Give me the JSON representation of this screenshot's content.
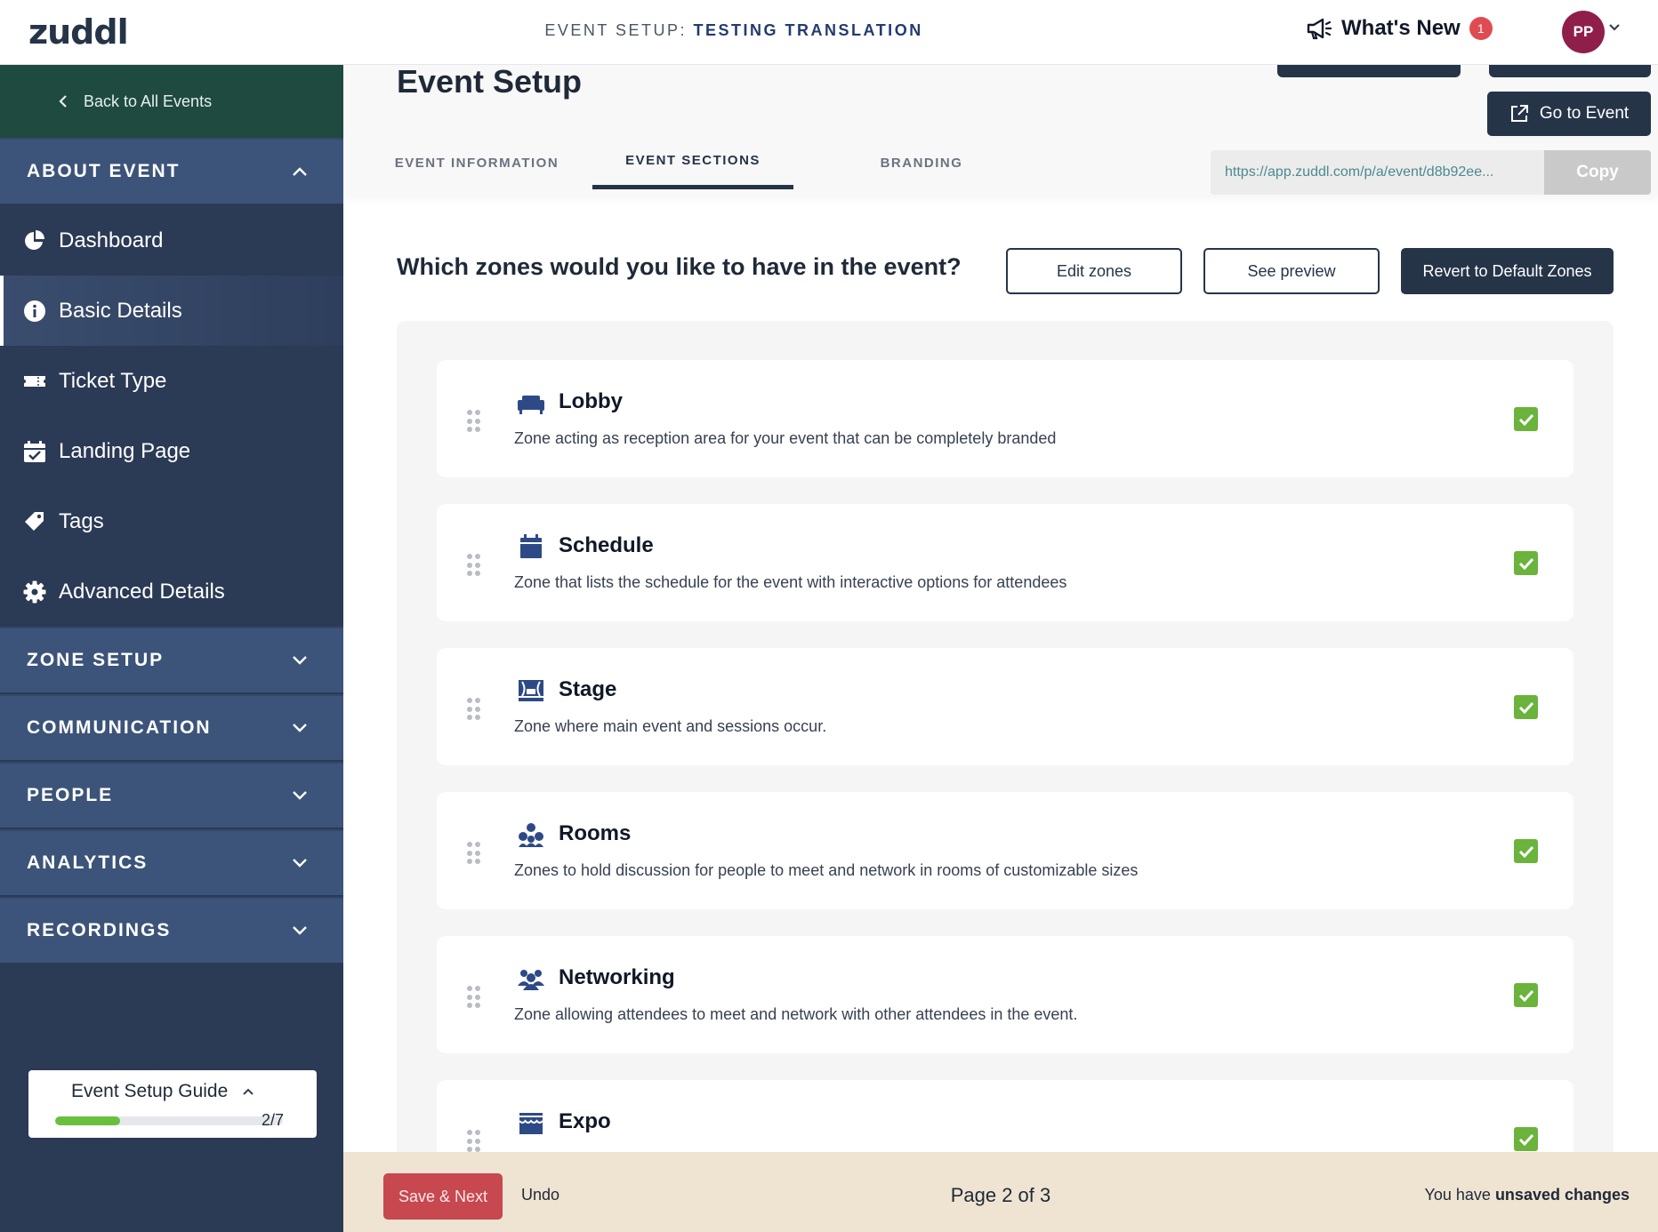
{
  "topbar": {
    "logo": "zuddl",
    "crumb_prefix": "EVENT SETUP:",
    "crumb_event": "TESTING TRANSLATION",
    "whats_new": "What's New",
    "whats_new_count": "1",
    "avatar_initials": "PP"
  },
  "sidebar": {
    "back_label": "Back to All Events",
    "about_event": "ABOUT EVENT",
    "items": [
      {
        "label": "Dashboard",
        "icon": "pie-chart-icon"
      },
      {
        "label": "Basic Details",
        "icon": "info-icon"
      },
      {
        "label": "Ticket Type",
        "icon": "ticket-icon"
      },
      {
        "label": "Landing Page",
        "icon": "calendar-check-icon"
      },
      {
        "label": "Tags",
        "icon": "tag-icon"
      },
      {
        "label": "Advanced Details",
        "icon": "gear-icon"
      }
    ],
    "sections": [
      "ZONE SETUP",
      "COMMUNICATION",
      "PEOPLE",
      "ANALYTICS",
      "RECORDINGS"
    ],
    "guide": {
      "title": "Event Setup Guide",
      "count": "2/7",
      "progress": 0.2857
    }
  },
  "main": {
    "title": "Event Setup",
    "go_to_event": "Go to Event",
    "tabs": [
      {
        "label": "EVENT INFORMATION",
        "active": false
      },
      {
        "label": "EVENT SECTIONS",
        "active": true
      },
      {
        "label": "BRANDING",
        "active": false
      }
    ],
    "url": "https://app.zuddl.com/p/a/event/d8b92ee...",
    "copy_label": "Copy",
    "question": "Which zones would you like to have in the event?",
    "edit_zones": "Edit zones",
    "see_preview": "See preview",
    "revert": "Revert to Default Zones",
    "zones": [
      {
        "title": "Lobby",
        "desc": "Zone acting as reception area for your event that can be completely branded",
        "icon": "sofa-icon",
        "checked": true
      },
      {
        "title": "Schedule",
        "desc": "Zone that lists the schedule for the event with interactive options for attendees",
        "icon": "calendar-icon",
        "checked": true
      },
      {
        "title": "Stage",
        "desc": "Zone where main event and sessions occur.",
        "icon": "theater-icon",
        "checked": true
      },
      {
        "title": "Rooms",
        "desc": "Zones to hold discussion for people to meet and network in rooms of customizable sizes",
        "icon": "people-group-icon",
        "checked": true
      },
      {
        "title": "Networking",
        "desc": "Zone allowing attendees to meet and network with other attendees in the event.",
        "icon": "networking-icon",
        "checked": true
      },
      {
        "title": "Expo",
        "desc": "",
        "icon": "store-icon",
        "checked": true
      }
    ]
  },
  "footer": {
    "save_next": "Save & Next",
    "undo": "Undo",
    "page_info": "Page 2 of 3",
    "unsaved_prefix": "You have",
    "unsaved_strong": "unsaved changes"
  },
  "colors": {
    "navy": "#263448",
    "sidebar": "#2b3a55",
    "section_header": "#3c5479",
    "back_row": "#1f4a40",
    "check_green": "#6bb33c",
    "save_red": "#c7484f",
    "footer_bg": "#efe3d2"
  }
}
